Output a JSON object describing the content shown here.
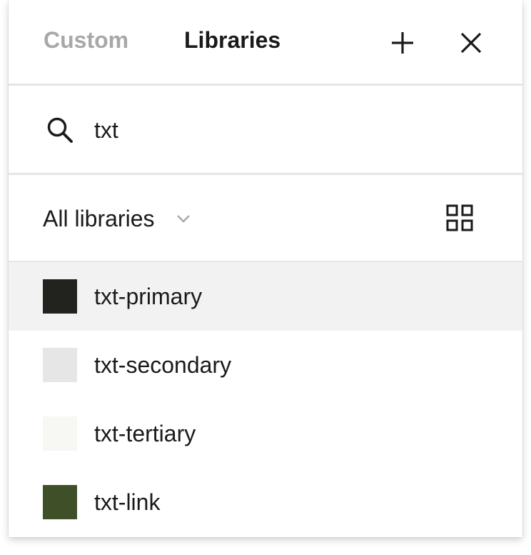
{
  "tabs": [
    {
      "label": "Custom",
      "active": false
    },
    {
      "label": "Libraries",
      "active": true
    }
  ],
  "header": {
    "add_icon": "plus-icon",
    "close_icon": "close-icon"
  },
  "search": {
    "icon": "search-icon",
    "value": "txt",
    "placeholder": ""
  },
  "filter": {
    "selected": "All libraries",
    "chevron_icon": "chevron-down-icon",
    "view_icon": "grid-view-icon"
  },
  "colors": {
    "tab_inactive": "#a8a8a8",
    "text": "#1a1a1a",
    "divider": "#e6e6e6",
    "selected_row": "#f2f2f2"
  },
  "items": [
    {
      "label": "txt-primary",
      "color": "#22231f",
      "selected": true
    },
    {
      "label": "txt-secondary",
      "color": "#e6e6e6",
      "selected": false
    },
    {
      "label": "txt-tertiary",
      "color": "#f7f8f4",
      "selected": false
    },
    {
      "label": "txt-link",
      "color": "#3f4f27",
      "selected": false
    }
  ]
}
